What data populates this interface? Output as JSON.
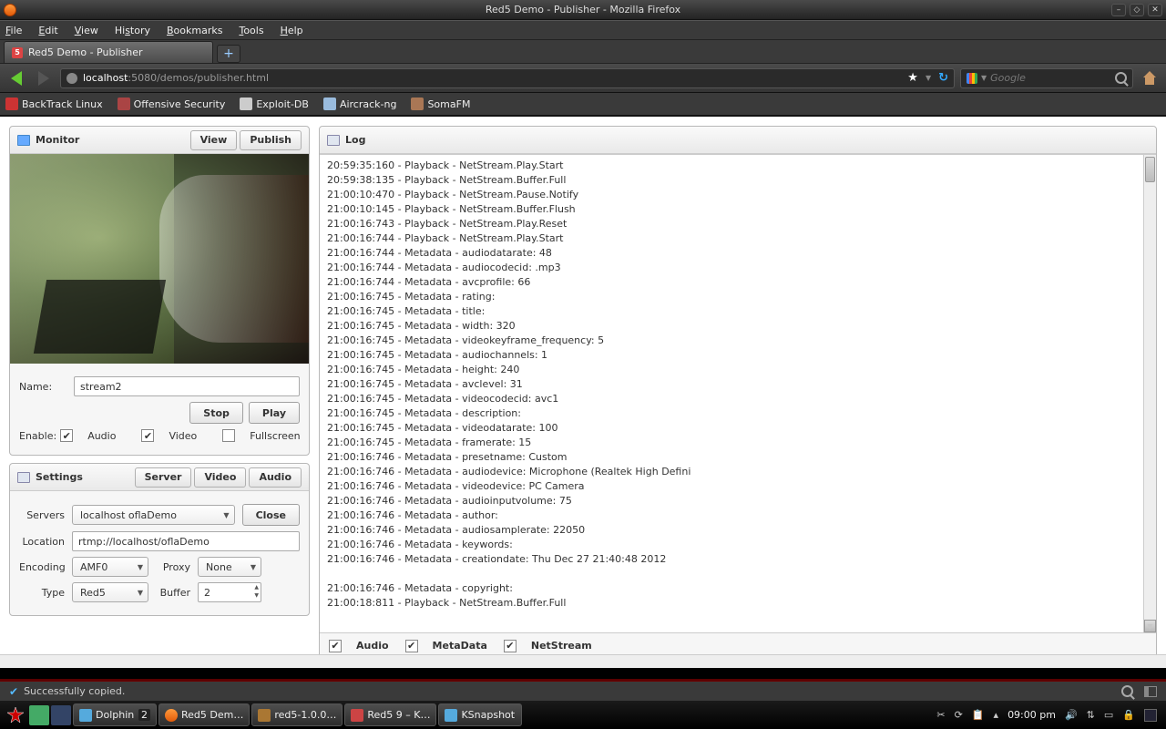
{
  "window": {
    "title": "Red5 Demo - Publisher - Mozilla Firefox"
  },
  "menubar": [
    "File",
    "Edit",
    "View",
    "History",
    "Bookmarks",
    "Tools",
    "Help"
  ],
  "tab": {
    "title": "Red5 Demo - Publisher"
  },
  "url": {
    "host": "localhost",
    "rest": ":5080/demos/publisher.html"
  },
  "search": {
    "placeholder": "Google"
  },
  "bookmarks": [
    "BackTrack Linux",
    "Offensive Security",
    "Exploit-DB",
    "Aircrack-ng",
    "SomaFM"
  ],
  "monitor": {
    "title": "Monitor",
    "tabs": {
      "view": "View",
      "publish": "Publish"
    },
    "name_label": "Name:",
    "name_value": "stream2",
    "stop": "Stop",
    "play": "Play",
    "enable_label": "Enable:",
    "audio": "Audio",
    "video": "Video",
    "fullscreen": "Fullscreen",
    "audio_checked": true,
    "video_checked": true,
    "fullscreen_checked": false
  },
  "settings": {
    "title": "Settings",
    "tabs": {
      "server": "Server",
      "video": "Video",
      "audio": "Audio"
    },
    "servers_label": "Servers",
    "servers_value": "localhost oflaDemo",
    "close": "Close",
    "location_label": "Location",
    "location_value": "rtmp://localhost/oflaDemo",
    "encoding_label": "Encoding",
    "encoding_value": "AMF0",
    "proxy_label": "Proxy",
    "proxy_value": "None",
    "type_label": "Type",
    "type_value": "Red5",
    "buffer_label": "Buffer",
    "buffer_value": "2"
  },
  "log": {
    "title": "Log",
    "entries": [
      "20:59:35:160 - Playback - NetStream.Play.Start",
      "20:59:38:135 - Playback - NetStream.Buffer.Full",
      "21:00:10:470 - Playback - NetStream.Pause.Notify",
      "21:00:10:145 - Playback - NetStream.Buffer.Flush",
      "21:00:16:743 - Playback - NetStream.Play.Reset",
      "21:00:16:744 - Playback - NetStream.Play.Start",
      "21:00:16:744 - Metadata - audiodatarate: 48",
      "21:00:16:744 - Metadata - audiocodecid: .mp3",
      "21:00:16:744 - Metadata - avcprofile: 66",
      "21:00:16:745 - Metadata - rating:",
      "21:00:16:745 - Metadata - title:",
      "21:00:16:745 - Metadata - width: 320",
      "21:00:16:745 - Metadata - videokeyframe_frequency: 5",
      "21:00:16:745 - Metadata - audiochannels: 1",
      "21:00:16:745 - Metadata - height: 240",
      "21:00:16:745 - Metadata - avclevel: 31",
      "21:00:16:745 - Metadata - videocodecid: avc1",
      "21:00:16:745 - Metadata - description:",
      "21:00:16:745 - Metadata - videodatarate: 100",
      "21:00:16:745 - Metadata - framerate: 15",
      "21:00:16:746 - Metadata - presetname: Custom",
      "21:00:16:746 - Metadata - audiodevice: Microphone (Realtek High Defini",
      "21:00:16:746 - Metadata - videodevice: PC Camera",
      "21:00:16:746 - Metadata - audioinputvolume: 75",
      "21:00:16:746 - Metadata - author:",
      "21:00:16:746 - Metadata - audiosamplerate: 22050",
      "21:00:16:746 - Metadata - keywords:",
      "21:00:16:746 - Metadata - creationdate: Thu Dec 27 21:40:48 2012",
      "",
      "21:00:16:746 - Metadata - copyright:",
      "21:00:18:811 - Playback - NetStream.Buffer.Full"
    ],
    "filters": {
      "audio": "Audio",
      "metadata": "MetaData",
      "netstream": "NetStream"
    }
  },
  "status": {
    "text": "Successfully copied."
  },
  "taskbar": {
    "tasks": [
      "Dolphin",
      "Red5 Dem…",
      "red5-1.0.0…",
      "Red5 9 – K…",
      "KSnapshot"
    ],
    "dolphin_count": "2",
    "clock": "09:00 pm"
  }
}
